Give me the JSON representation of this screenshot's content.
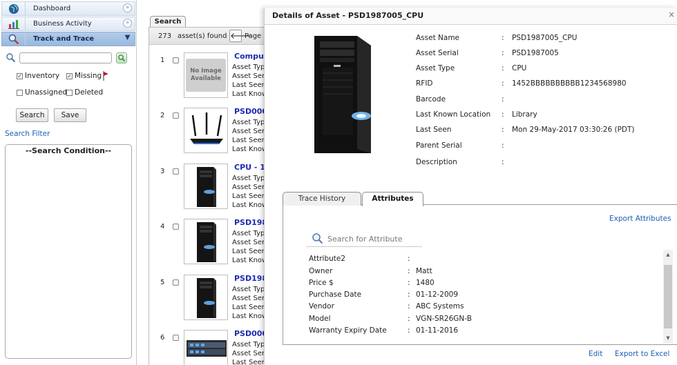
{
  "sidebar": {
    "nav": [
      {
        "label": "Dashboard",
        "icon": "globe-icon"
      },
      {
        "label": "Business Activity",
        "icon": "bar-chart-icon"
      },
      {
        "label": "Track and Trace",
        "icon": "magnifier-icon"
      }
    ],
    "search_value": "",
    "filters": {
      "inventory": "Inventory",
      "missing": "Missing",
      "unassigned": "Unassigned",
      "deleted": "Deleted"
    },
    "search_button": "Search",
    "save_button": "Save",
    "search_filter_link": "Search Filter",
    "condition_title": "--Search Condition--"
  },
  "results": {
    "tab_label": "Search",
    "count": "273",
    "found_label": "asset(s) found",
    "page_label": "Page",
    "no_image_text": "No Image Available",
    "rows": [
      {
        "num": "1",
        "title": "Comput",
        "lines": [
          "Asset Typ",
          "Asset Seri",
          "Last Seen",
          "Last Known"
        ]
      },
      {
        "num": "2",
        "title": "PSD000",
        "lines": [
          "Asset Typ",
          "Asset Seri",
          "Last Seen",
          "Last Known"
        ]
      },
      {
        "num": "3",
        "title": "CPU - 1",
        "lines": [
          "Asset Typ",
          "Asset Seri",
          "Last Seen",
          "Last Know"
        ]
      },
      {
        "num": "4",
        "title": "PSD198",
        "lines": [
          "Asset Typ",
          "Asset Seri",
          "Last Seen",
          "Last Know"
        ]
      },
      {
        "num": "5",
        "title": "PSD198",
        "lines": [
          "Asset Typ",
          "Asset Seri",
          "Last Seen",
          "Last Know"
        ]
      },
      {
        "num": "6",
        "title": "PSD000",
        "lines": [
          "Asset Typ",
          "Asset Seri",
          "Last Seen"
        ]
      }
    ]
  },
  "details": {
    "title": "Details of Asset - PSD1987005_CPU",
    "close": "×",
    "fields": [
      {
        "label": "Asset Name",
        "value": "PSD1987005_CPU"
      },
      {
        "label": "Asset Serial",
        "value": "PSD1987005"
      },
      {
        "label": "Asset Type",
        "value": "CPU"
      },
      {
        "label": "RFID",
        "value": "1452BBBBBBBBBB1234568980"
      },
      {
        "label": "Barcode",
        "value": ""
      },
      {
        "label": "Last Known Location",
        "value": "Library"
      },
      {
        "label": "Last Seen",
        "value": "Mon 29-May-2017 03:30:26 (PDT)"
      },
      {
        "label": "Parent Serial",
        "value": ""
      },
      {
        "label": "Description",
        "value": ""
      }
    ],
    "tabs": {
      "trace": "Trace History",
      "attributes": "Attributes"
    },
    "export_attributes": "Export Attributes",
    "attr_search_placeholder": "Search for Attribute",
    "attributes": [
      {
        "label": "Attribute2",
        "value": ""
      },
      {
        "label": "Owner",
        "value": "Matt"
      },
      {
        "label": "Price $",
        "value": "1480"
      },
      {
        "label": "Purchase Date",
        "value": "01-12-2009"
      },
      {
        "label": "Vendor",
        "value": "ABC Systems"
      },
      {
        "label": "Model",
        "value": "VGN-SR26GN-B"
      },
      {
        "label": "Warranty Expiry Date",
        "value": "01-11-2016"
      }
    ],
    "edit": "Edit",
    "export_excel": "Export to Excel"
  },
  "colors": {
    "link": "#1a5fb4",
    "result_title": "#1d2bb0",
    "active_nav": "#9ab9df"
  }
}
